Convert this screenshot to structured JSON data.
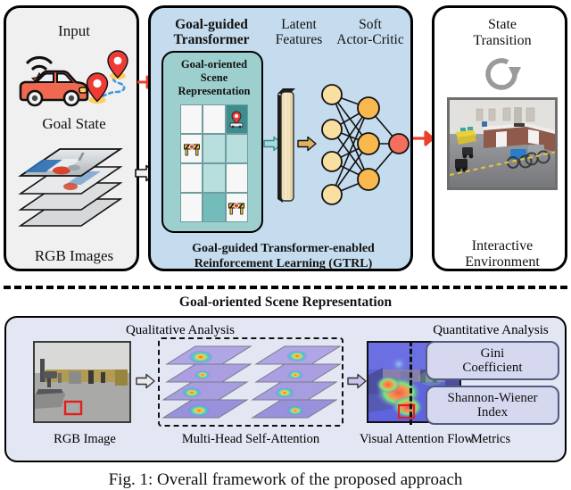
{
  "figure": {
    "caption": "Fig. 1: Overall framework of the proposed approach"
  },
  "top": {
    "input_panel": {
      "title": "Input",
      "goal_state_label": "Goal State",
      "rgb_images_label": "RGB Images",
      "icons": {
        "vehicle": "car-wifi-icon",
        "waypoint_a": "map-pin-icon",
        "waypoint_b": "map-pin-icon",
        "path": "dashed-path-icon",
        "stack": "image-stack-icon"
      }
    },
    "gtrl_panel": {
      "transformer_title": "Goal-guided\nTransformer",
      "transformer_title_line1": "Goal-guided",
      "transformer_title_line2": "Transformer",
      "latent_title_line1": "Latent",
      "latent_title_line2": "Features",
      "sac_title_line1": "Soft",
      "sac_title_line2": "Actor-Critic",
      "gosr_title_line1": "Goal-oriented",
      "gosr_title_line2": "Scene",
      "gosr_title_line3": "Representation",
      "footer_line1": "Goal-guided Transformer-enabled",
      "footer_line2": "Reinforcement Learning (GTRL)",
      "grid": {
        "rows": 4,
        "cols": 3,
        "cells": [
          [
            {
              "tone": "empty",
              "icon": ""
            },
            {
              "tone": "empty",
              "icon": ""
            },
            {
              "tone": "goal",
              "icon": "goal-marker-icon"
            }
          ],
          [
            {
              "tone": "empty",
              "icon": "barrier-icon"
            },
            {
              "tone": "light",
              "icon": ""
            },
            {
              "tone": "light",
              "icon": ""
            }
          ],
          [
            {
              "tone": "empty",
              "icon": ""
            },
            {
              "tone": "light",
              "icon": ""
            },
            {
              "tone": "empty",
              "icon": ""
            }
          ],
          [
            {
              "tone": "empty",
              "icon": ""
            },
            {
              "tone": "mid",
              "icon": ""
            },
            {
              "tone": "empty",
              "icon": "barrier-icon"
            }
          ]
        ]
      },
      "network": {
        "input_nodes": 4,
        "hidden_nodes": 3,
        "output_nodes": 1,
        "input_color": "#fae0a0",
        "hidden_color": "#f9b94e",
        "output_color": "#f4705c"
      }
    },
    "env_panel": {
      "title_line1": "State",
      "title_line2": "Transition",
      "footer_line1": "Interactive",
      "footer_line2": "Environment",
      "rotate_icon": "refresh-circular-arrow-icon",
      "photo": "indoor-lab-environment-photo"
    }
  },
  "bottom": {
    "section_title": "Goal-oriented Scene Representation",
    "qualitative_label": "Qualitative Analysis",
    "quantitative_label": "Quantitative Analysis",
    "rgb_image_label": "RGB Image",
    "mhsa_label": "Multi-Head Self-Attention",
    "vaf_label": "Visual Attention Flow",
    "metrics_label": "Metrics",
    "metrics": [
      {
        "line1": "Gini",
        "line2": "Coefficient"
      },
      {
        "line1": "Shannon-Wiener",
        "line2": "Index"
      }
    ],
    "attention_groups": 2,
    "attention_maps_per_group": 4
  },
  "colors": {
    "panel_input_bg": "#f0f0f0",
    "panel_gtrl_bg": "#c5dcee",
    "panel_env_bg": "#ffffff",
    "gosr_bg": "#9ecfcf",
    "bottom_bg": "#e3e6f3",
    "metric_chip_bg": "#d5d8ef",
    "arrow_red": "#e8422f",
    "arrow_gray": "#f2f2f2",
    "arrow_teal": "#a6d9d9",
    "arrow_tan": "#e0b25f",
    "arrow_lavender": "#c9c3ea",
    "latent_bar": "#f5e6bd"
  }
}
